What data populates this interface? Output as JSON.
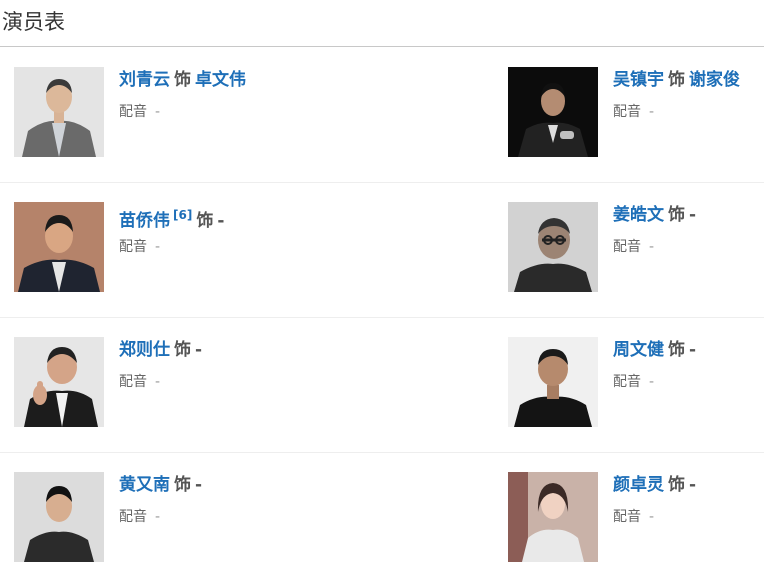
{
  "section": {
    "title": "演员表"
  },
  "labels": {
    "as_word": "饰",
    "voice_label": "配音",
    "empty": "-"
  },
  "cast": [
    {
      "actor": "刘青云",
      "role": "卓文伟",
      "ref": "",
      "voice": "-"
    },
    {
      "actor": "吴镇宇",
      "role": "谢家俊",
      "ref": "",
      "voice": "-"
    },
    {
      "actor": "苗侨伟",
      "role": "",
      "ref": "[6]",
      "voice": "-"
    },
    {
      "actor": "姜皓文",
      "role": "",
      "ref": "",
      "voice": "-"
    },
    {
      "actor": "郑则仕",
      "role": "",
      "ref": "",
      "voice": "-"
    },
    {
      "actor": "周文健",
      "role": "",
      "ref": "",
      "voice": "-"
    },
    {
      "actor": "黄又南",
      "role": "",
      "ref": "",
      "voice": "-"
    },
    {
      "actor": "颜卓灵",
      "role": "",
      "ref": "",
      "voice": "-"
    }
  ]
}
